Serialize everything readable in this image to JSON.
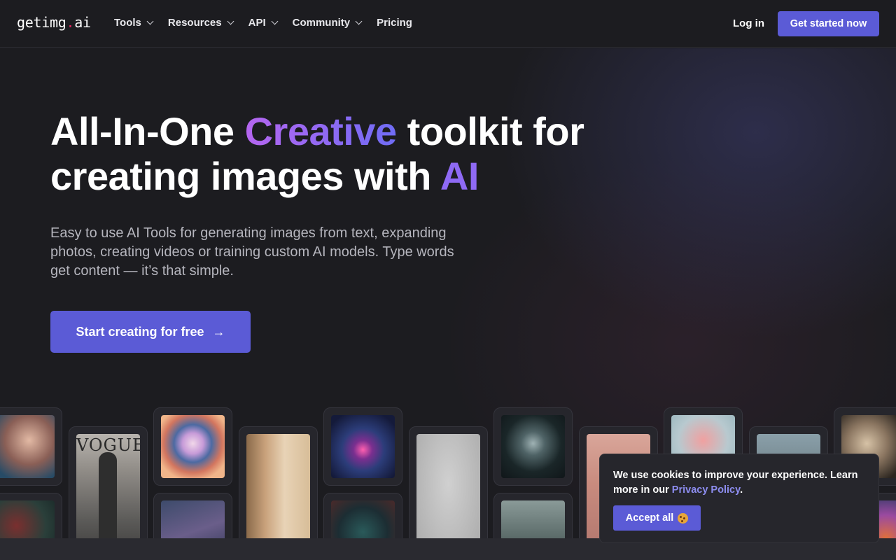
{
  "nav": {
    "logo_main": "getimg",
    "logo_dot": ".",
    "logo_tld": "ai",
    "links": [
      {
        "label": "Tools",
        "has_dropdown": true
      },
      {
        "label": "Resources",
        "has_dropdown": true
      },
      {
        "label": "API",
        "has_dropdown": true
      },
      {
        "label": "Community",
        "has_dropdown": true
      },
      {
        "label": "Pricing",
        "has_dropdown": false
      }
    ],
    "login_label": "Log in",
    "cta_label": "Get started now"
  },
  "hero": {
    "headline_part1": "All-In-One ",
    "headline_highlight1": "Creative",
    "headline_part2": " toolkit for creating images with ",
    "headline_highlight2": "AI",
    "subtitle": "Easy to use AI Tools for generating images from text, expanding photos, creating videos or training custom AI models. Type words get content — it’s that simple.",
    "cta_label": "Start creating for free",
    "cta_arrow": "→"
  },
  "gallery": {
    "vogue_text": "VOGUE"
  },
  "cookie": {
    "text_before": "We use cookies to improve your experience. Learn more in our ",
    "link_label": "Privacy Policy",
    "text_after": ".",
    "accept_label": "Accept all"
  },
  "colors": {
    "accent": "#5b5bd6",
    "background": "#1c1c20",
    "gradient_start": "#b566f0",
    "gradient_end": "#6f6cf5"
  }
}
